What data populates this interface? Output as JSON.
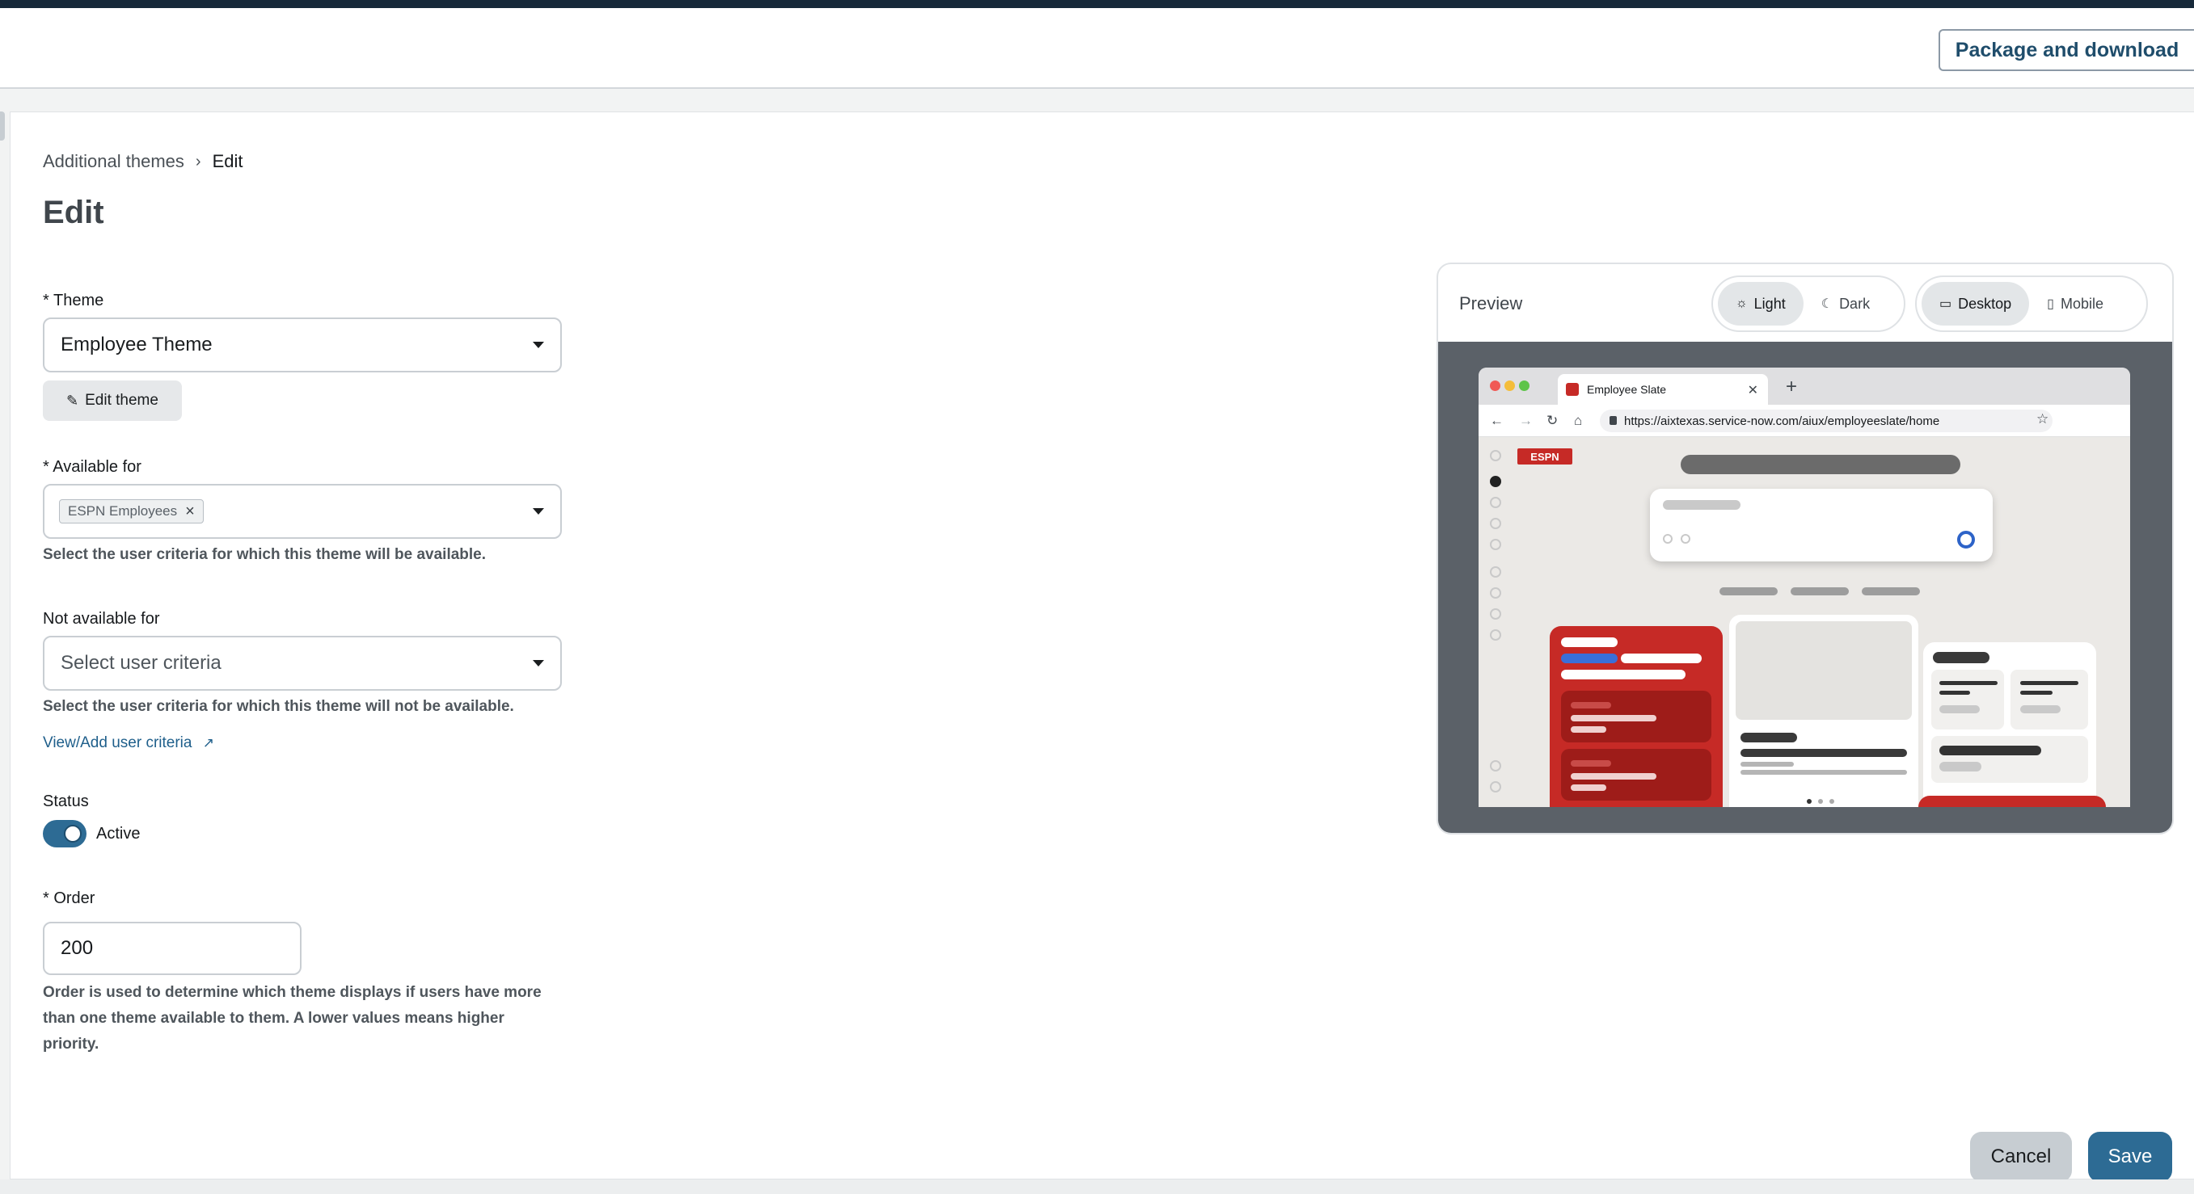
{
  "header": {
    "package_download_label": "Package and download"
  },
  "breadcrumb": {
    "parent": "Additional themes",
    "separator": "›",
    "current": "Edit"
  },
  "page_title": "Edit",
  "form": {
    "theme": {
      "label": "* Theme",
      "value": "Employee Theme",
      "edit_button_label": "Edit theme"
    },
    "available_for": {
      "label": "* Available for",
      "chip": "ESPN Employees",
      "help": "Select the user criteria for which this theme will be available."
    },
    "not_available_for": {
      "label": "Not available for",
      "placeholder": "Select user criteria",
      "help": "Select the user criteria for which this theme will not be available."
    },
    "view_add_link": "View/Add user criteria",
    "status": {
      "label": "Status",
      "value": "Active",
      "on": true
    },
    "order": {
      "label": "* Order",
      "value": "200",
      "help": "Order is used to determine which theme displays if users have more than one theme available to them. A lower values means higher priority."
    }
  },
  "preview": {
    "title": "Preview",
    "mode_options": [
      "Light",
      "Dark"
    ],
    "mode_selected": "Light",
    "device_options": [
      "Desktop",
      "Mobile"
    ],
    "device_selected": "Desktop",
    "browser": {
      "tab_title": "Employee Slate",
      "url": "https://aixtexas.service-now.com/aiux/employeeslate/home",
      "logo_text": "ESPN"
    }
  },
  "actions": {
    "cancel": "Cancel",
    "save": "Save"
  },
  "colors": {
    "primary": "#2d6b94",
    "topbar": "#17293a",
    "brand_red": "#c62a26"
  }
}
